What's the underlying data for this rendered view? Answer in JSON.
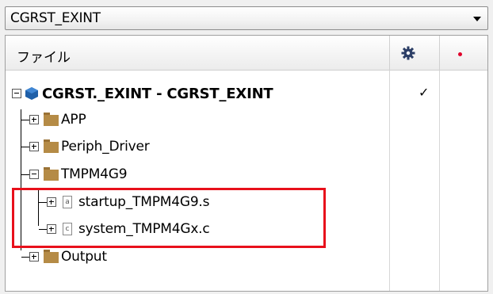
{
  "combo": {
    "value": "CGRST_EXINT"
  },
  "header": {
    "file_label": "ファイル"
  },
  "tree": {
    "project_label": "CGRST._EXINT - CGRST_EXINT",
    "project_check": "✓",
    "items": [
      {
        "label": "APP"
      },
      {
        "label": "Periph_Driver"
      },
      {
        "label": "TMPM4G9"
      },
      {
        "label": "startup_TMPM4G9.s",
        "icon_letter": "a"
      },
      {
        "label": "system_TMPM4Gx.c",
        "icon_letter": "c"
      },
      {
        "label": "Output"
      }
    ]
  },
  "colors": {
    "folder": "#b58b46",
    "project": "#1e5fa8",
    "highlight": "#e8101b",
    "dot": "#e0002a"
  }
}
